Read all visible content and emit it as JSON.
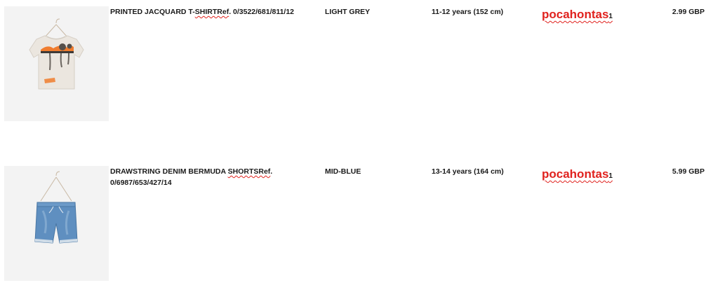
{
  "orders": [
    {
      "name_main": "PRINTED JACQUARD T-",
      "name_spell": "SHIRTRef",
      "name_rest": ". 0/3522/681/811/12",
      "color": "LIGHT GREY",
      "size": "11-12 years (152 cm)",
      "brand": "pocahontas",
      "quantity": "1",
      "price": "2.99 GBP",
      "image": "tshirt-product-image"
    },
    {
      "name_main": "DRAWSTRING DENIM BERMUDA ",
      "name_spell": "SHORTSRef",
      "name_rest": ". 0/6987/653/427/14",
      "color": "MID-BLUE",
      "size": "13-14 years (164 cm)",
      "brand": "pocahontas",
      "quantity": "1",
      "price": "5.99 GBP",
      "image": "shorts-product-image"
    }
  ],
  "colors": {
    "accent_red": "#e0221e",
    "thumb_bg": "#f3f3f3"
  }
}
